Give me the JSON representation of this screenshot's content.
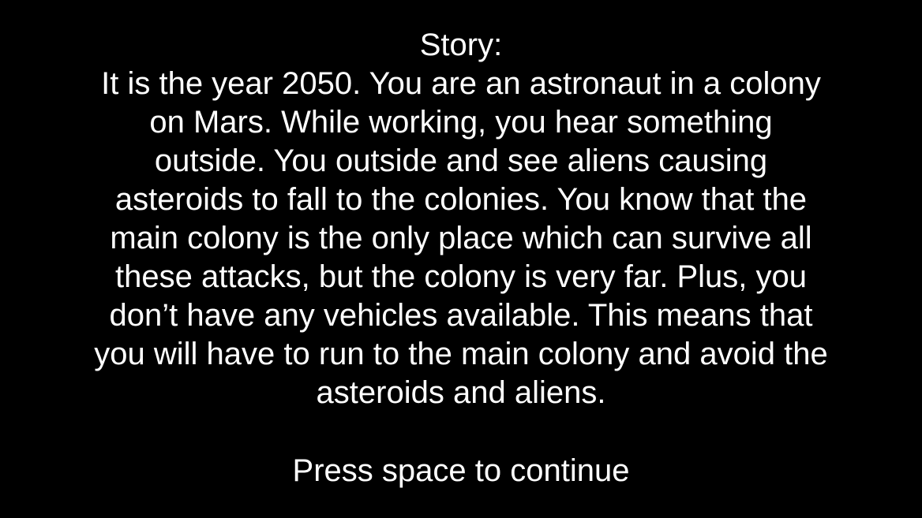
{
  "story": {
    "heading": "Story:",
    "lines": [
      "It is the year 2050. You are an astronaut in a colony",
      "on Mars. While working, you hear something",
      "outside. You outside and see aliens causing",
      "asteroids to fall to the colonies. You know that the",
      "main colony is the only place which can survive all",
      "these attacks, but the colony is very far. Plus, you",
      "don’t have any vehicles available. This means that",
      "you will have to run to the main colony and avoid the",
      "asteroids and aliens."
    ]
  },
  "prompt": {
    "text": "Press space to continue"
  },
  "colors": {
    "background": "#000000",
    "text": "#ffffff"
  }
}
